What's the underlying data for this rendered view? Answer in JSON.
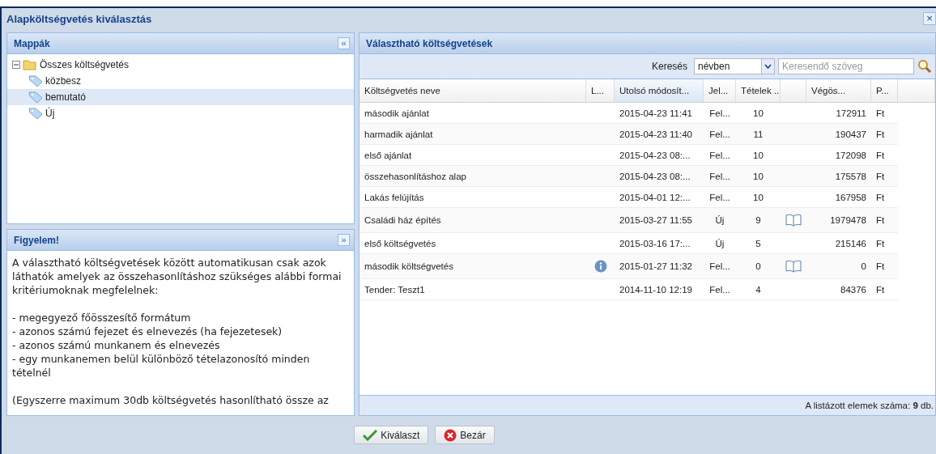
{
  "window": {
    "title": "Alapköltségvetés kiválasztás",
    "close": "×"
  },
  "folders": {
    "title": "Mappák",
    "collapse": "«",
    "tree": [
      {
        "label": "Összes költségvetés",
        "expanded": true,
        "selected": false,
        "children": [
          {
            "label": "közbesz",
            "selected": false
          },
          {
            "label": "bemutató",
            "selected": true
          },
          {
            "label": "Új",
            "selected": false
          }
        ]
      }
    ]
  },
  "notice": {
    "title": "Figyelem!",
    "expand": "»",
    "paragraphs": [
      "A választható költségvetések között automatikusan csak azok láthatók amelyek az összehasonlításhoz szükséges alábbi formai kritériumoknak megfelelnek:",
      "- megegyező főösszesítő formátum\n- azonos számú fejezet és elnevezés (ha fejezetesek)\n- azonos számú munkanem és elnevezés\n- egy munkanemen belül különböző tételazonosító minden tételnél",
      "(Egyszerre maximum 30db költségvetés hasonlítható össze az"
    ]
  },
  "budgets": {
    "title": "Választható költségvetések",
    "search": {
      "label": "Keresés",
      "scope": "névben",
      "placeholder": "Keresendő szöveg"
    },
    "columns": [
      {
        "label": "Költségvetés neve",
        "sorted": false
      },
      {
        "label": "L...",
        "sorted": false
      },
      {
        "label": "Utolsó módosít...",
        "sorted": true
      },
      {
        "label": "Jel...",
        "sorted": false
      },
      {
        "label": "Tételek ...",
        "sorted": false
      },
      {
        "sorted": false
      },
      {
        "label": "Végös...",
        "sorted": false
      },
      {
        "label": "P...",
        "sorted": false
      }
    ],
    "rows": [
      {
        "name": "második ajánlat",
        "info": false,
        "modified": "2015-04-23 11:41",
        "status": "Fel...",
        "items": "10",
        "book": false,
        "total": "172911",
        "currency": "Ft"
      },
      {
        "name": "harmadik ajánlat",
        "info": false,
        "modified": "2015-04-23 11:40",
        "status": "Fel...",
        "items": "11",
        "book": false,
        "total": "190437",
        "currency": "Ft"
      },
      {
        "name": "első ajánlat",
        "info": false,
        "modified": "2015-04-23 08:...",
        "status": "Fel...",
        "items": "10",
        "book": false,
        "total": "172098",
        "currency": "Ft"
      },
      {
        "name": "összehasonlításhoz alap",
        "info": false,
        "modified": "2015-04-23 08:...",
        "status": "Fel...",
        "items": "10",
        "book": false,
        "total": "175578",
        "currency": "Ft"
      },
      {
        "name": "Lakás felújítás",
        "info": false,
        "modified": "2015-04-01 12:...",
        "status": "Fel...",
        "items": "10",
        "book": false,
        "total": "167958",
        "currency": "Ft"
      },
      {
        "name": "Családi ház építés",
        "info": false,
        "modified": "2015-03-27 11:55",
        "status": "Új",
        "items": "9",
        "book": true,
        "total": "1979478",
        "currency": "Ft"
      },
      {
        "name": "első költségvetés",
        "info": false,
        "modified": "2015-03-16 17:...",
        "status": "Új",
        "items": "5",
        "book": false,
        "total": "215146",
        "currency": "Ft"
      },
      {
        "name": "második költségvetés",
        "info": true,
        "modified": "2015-01-27 11:32",
        "status": "Fel...",
        "items": "0",
        "book": true,
        "total": "0",
        "currency": "Ft"
      },
      {
        "name": "Tender: Teszt1",
        "info": false,
        "modified": "2014-11-10 12:19",
        "status": "Fel...",
        "items": "4",
        "book": false,
        "total": "84376",
        "currency": "Ft"
      }
    ],
    "footer": "A listázott elemek száma: **9** db."
  },
  "buttons": [
    {
      "kind": "select",
      "label": "Kiválaszt"
    },
    {
      "kind": "close",
      "label": "Bezár"
    }
  ]
}
